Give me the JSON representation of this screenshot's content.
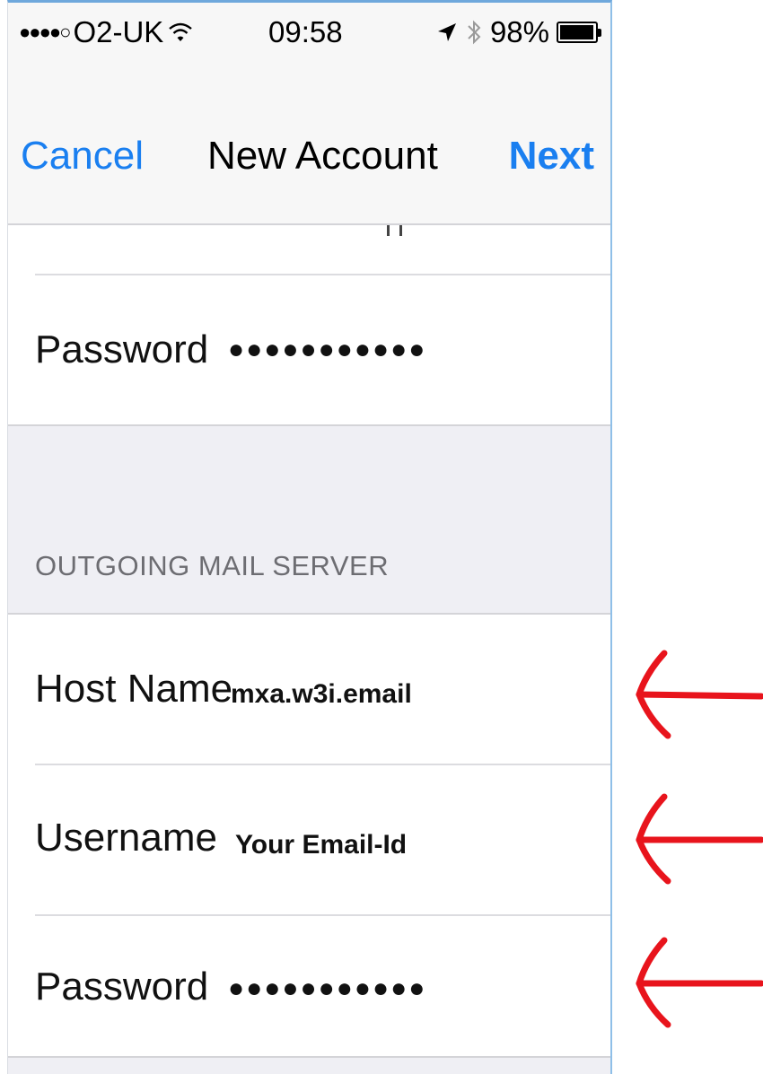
{
  "status_bar": {
    "signal_dots": "●●●●○",
    "carrier": "O2-UK",
    "time": "09:58",
    "battery_percent": "98%",
    "battery_level": 0.98
  },
  "nav": {
    "cancel_label": "Cancel",
    "title": "New Account",
    "next_label": "Next"
  },
  "incoming": {
    "password_label": "Password",
    "password_value": "●●●●●●●●●●●"
  },
  "outgoing": {
    "section_header": "OUTGOING MAIL SERVER",
    "host_label": "Host Name",
    "host_value": "mxa.w3i.email",
    "username_label": "Username",
    "username_value": "Your Email-Id",
    "password_label": "Password",
    "password_value": "●●●●●●●●●●●"
  },
  "annotation": {
    "arrow_color": "#e8141c"
  },
  "colors": {
    "ios_blue": "#1a7ff0",
    "group_background": "#efeff4"
  }
}
